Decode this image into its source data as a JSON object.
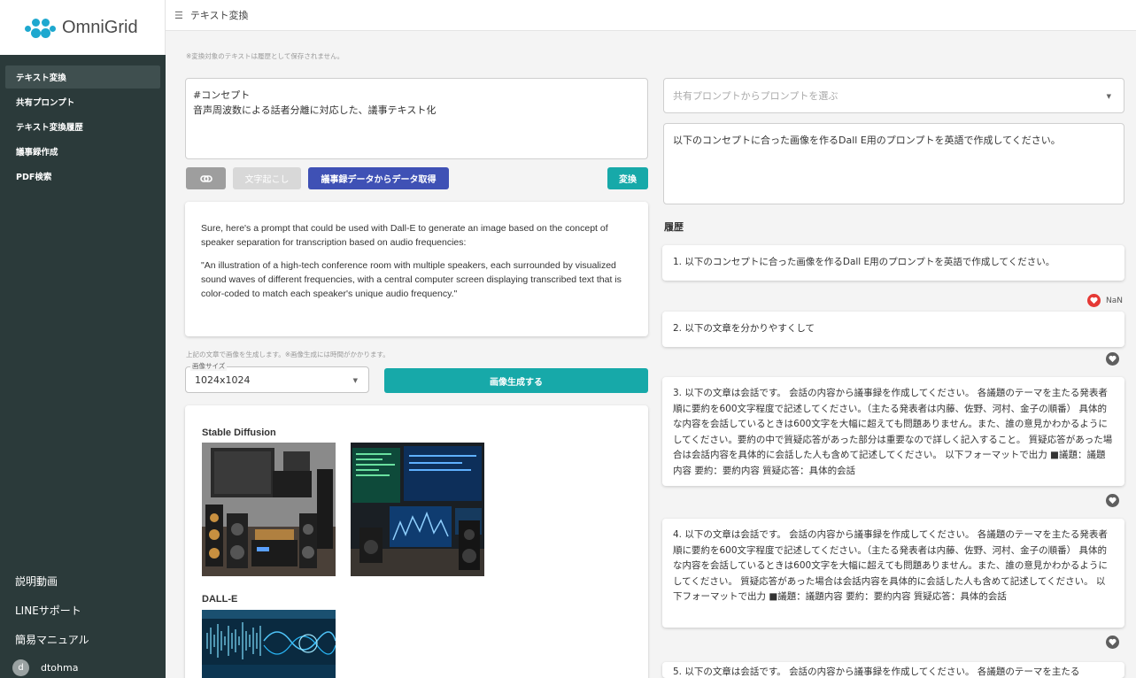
{
  "app": {
    "logo_text": "OmniGrid",
    "brand_color": "#1ea8cf",
    "accent_color": "#17a9a9"
  },
  "sidebar": {
    "items": [
      {
        "label": "テキスト変換",
        "active": true
      },
      {
        "label": "共有プロンプト"
      },
      {
        "label": "テキスト変換履歴"
      },
      {
        "label": "議事録作成"
      },
      {
        "label": "PDF検索"
      }
    ],
    "bottom": [
      {
        "label": "説明動画"
      },
      {
        "label": "LINEサポート"
      },
      {
        "label": "簡易マニュアル"
      }
    ],
    "user": {
      "initial": "d",
      "name": "dtohma"
    }
  },
  "header": {
    "title": "テキスト変換"
  },
  "main": {
    "notice": "※変換対象のテキストは履歴として保存されません。",
    "concept": {
      "line1": "#コンセプト",
      "line2": "音声周波数による話者分離に対応した、議事テキスト化"
    },
    "buttons": {
      "transcribe": "文字起こし",
      "minutes_fetch": "議事録データからデータ取得",
      "convert": "変換"
    },
    "result": {
      "p1": "Sure, here's a prompt that could be used with Dall-E to generate an image based on the concept of speaker separation for transcription based on audio frequencies:",
      "p2": "\"An illustration of a high-tech conference room with multiple speakers, each surrounded by visualized sound waves of different frequencies, with a central computer screen displaying transcribed text that is color-coded to match each speaker's unique audio frequency.\""
    },
    "image_note": "上記の文章で画像を生成します。※画像生成には時間がかかります。",
    "image_size": {
      "label": "画像サイズ",
      "value": "1024x1024"
    },
    "generate_label": "画像生成する",
    "images": {
      "sd_title": "Stable Diffusion",
      "dalle_title": "DALL-E"
    }
  },
  "right": {
    "prompt_select_placeholder": "共有プロンプトからプロンプトを選ぶ",
    "prompt_text": "以下のコンセプトに合った画像を作るDall E用のプロンプトを英語で作成してください。",
    "history_title": "履歴",
    "history": [
      {
        "text": "1. 以下のコンセプトに合った画像を作るDall E用のプロンプトを英語で作成してください。",
        "likes": "NaN"
      },
      {
        "text": "2. 以下の文章を分かりやすくして"
      },
      {
        "text": "3. 以下の文章は会話です。 会話の内容から議事録を作成してください。 各議題のテーマを主たる発表者順に要約を600文字程度で記述してください。（主たる発表者は内藤、佐野、河村、金子の順番） 具体的な内容を会話しているときは600文字を大幅に超えても問題ありません。また、誰の意見かわかるようにしてください。要約の中で質疑応答があった部分は重要なので詳しく記入すること。 質疑応答があった場合は会話内容を具体的に会話した人も含めて記述してください。 以下フォーマットで出力 ■議題：議題内容 要約：要約内容 質疑応答：具体的会話"
      },
      {
        "text": "4. 以下の文章は会話です。 会話の内容から議事録を作成してください。 各議題のテーマを主たる発表者順に要約を600文字程度で記述してください。（主たる発表者は内藤、佐野、河村、金子の順番） 具体的な内容を会話しているときは600文字を大幅に超えても問題ありません。また、誰の意見かわかるようにしてください。 質疑応答があった場合は会話内容を具体的に会話した人も含めて記述してください。 以下フォーマットで出力 ■議題：議題内容 要約：要約内容 質疑応答：具体的会話"
      },
      {
        "text": "5. 以下の文章は会話です。 会話の内容から議事録を作成してください。 各議題のテーマを主たる"
      }
    ]
  }
}
